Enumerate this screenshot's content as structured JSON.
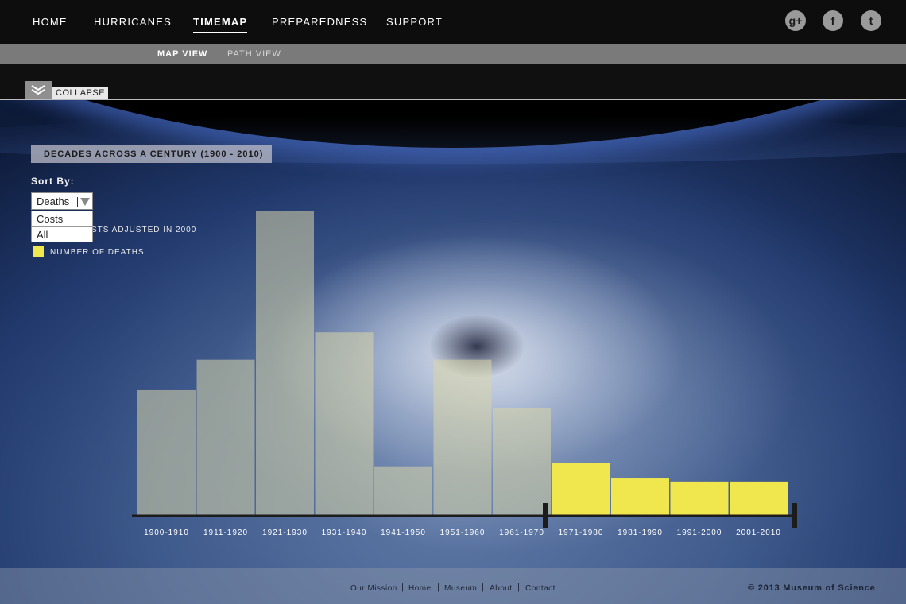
{
  "nav": {
    "items": [
      "HOME",
      "HURRICANES",
      "TIMEMAP",
      "PREPAREDNESS",
      "SUPPORT"
    ],
    "active": "TIMEMAP",
    "social": [
      {
        "name": "google-plus-icon",
        "glyph": "g+"
      },
      {
        "name": "facebook-icon",
        "glyph": "f"
      },
      {
        "name": "twitter-icon",
        "glyph": "t"
      }
    ]
  },
  "subnav": {
    "map_view": "MAP VIEW",
    "path_view": "PATH VIEW",
    "active": "MAP VIEW"
  },
  "collapse": {
    "label": "COLLAPSE"
  },
  "panel": {
    "title": "DECADES ACROSS A CENTURY  (1900 - 2010)",
    "sort_label": "Sort By:",
    "select_value": "Deaths",
    "options": [
      "Costs",
      "All"
    ],
    "legend_costs_partial": "STS ADJUSTED IN 2000",
    "legend_deaths": "NUMBER OF DEATHS"
  },
  "chart_data": {
    "type": "bar",
    "categories": [
      "1900-1910",
      "1911-1920",
      "1921-1930",
      "1931-1940",
      "1941-1950",
      "1951-1960",
      "1961-1970",
      "1971-1980",
      "1981-1990",
      "1991-2000",
      "2001-2010"
    ],
    "values": [
      0.41,
      0.51,
      1.0,
      0.6,
      0.16,
      0.51,
      0.35,
      0.17,
      0.12,
      0.11,
      0.11
    ],
    "value_scale": "relative (tallest = 1.0)",
    "highlighted_range": [
      "1971-1980",
      "2001-2010"
    ],
    "colors": {
      "highlight": "#f0e64e",
      "faded": "#d9d5a8"
    }
  },
  "footer": {
    "links": [
      "Our Mission",
      "Home",
      "Museum",
      "About",
      "Contact"
    ],
    "copyright": "©  2013 Museum of Science"
  }
}
